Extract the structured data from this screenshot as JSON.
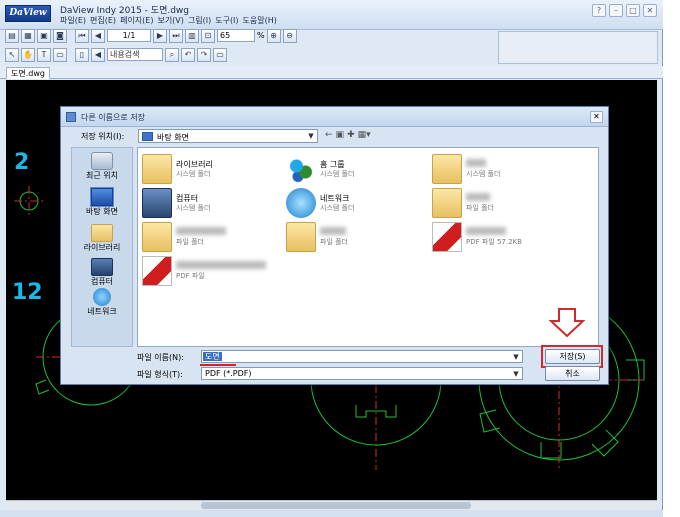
{
  "app": {
    "logo_text": "DaView",
    "title": "DaView Indy 2015 - 도면.dwg",
    "menu": [
      "파일(E)",
      "편집(E)",
      "페이지(E)",
      "보기(V)",
      "그림(I)",
      "도구(I)",
      "도움말(H)"
    ],
    "window_controls": [
      "?",
      "–",
      "□",
      "✕"
    ]
  },
  "toolbar": {
    "page_value": "1/1",
    "zoom_value": "65",
    "zoom_unit": "%",
    "search_placeholder": "내용검색"
  },
  "document_tab": "도면.dwg",
  "cad": {
    "labels": [
      "2",
      "12"
    ],
    "colors": {
      "background": "#000000",
      "geometry": "#1fbf3a",
      "center_lines": "#d52a2a",
      "label": "#19b8e6"
    }
  },
  "dialog": {
    "title": "다른 이름으로 저장",
    "close": "✕",
    "look_in_label": "저장 위치(I):",
    "look_in_value": "바탕 화면",
    "places": [
      "최근 위치",
      "바탕 화면",
      "라이브러리",
      "컴퓨터",
      "네트워크"
    ],
    "files": [
      {
        "name": "라이브러리",
        "sub": "시스템 폴더"
      },
      {
        "name": "홈 그룹",
        "sub": "시스템 폴더"
      },
      {
        "name": "",
        "sub": "시스템 폴더",
        "blurred": true
      },
      {
        "name": "컴퓨터",
        "sub": "시스템 폴더"
      },
      {
        "name": "네트워크",
        "sub": "시스템 폴더"
      },
      {
        "name": "",
        "sub": "파일 폴더",
        "blurred": true
      },
      {
        "name": "",
        "sub": "파일 폴더",
        "blurred": true
      },
      {
        "name": "",
        "sub": "파일 폴더",
        "blurred": true
      },
      {
        "name": "",
        "sub": "PDF 파일 57.2KB",
        "blurred": true
      },
      {
        "name": "",
        "sub": "PDF 파일",
        "blurred": true
      }
    ],
    "file_name_label": "파일 이름(N):",
    "file_name_value": "도면",
    "file_type_label": "파일 형식(T):",
    "file_type_value": "PDF (*.PDF)",
    "save_button": "저장(S)",
    "cancel_button": "취소"
  }
}
